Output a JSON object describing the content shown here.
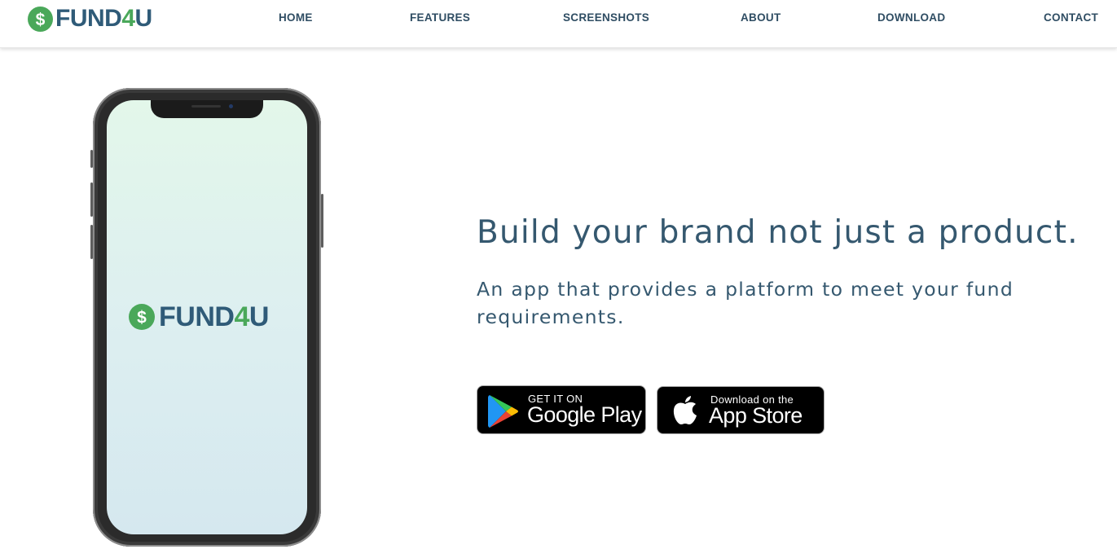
{
  "brand": {
    "name_part_a": "FUND",
    "name_part_b": "4",
    "name_part_c": "U",
    "coin_symbol": "$",
    "icon": "dollar-coin-icon",
    "colors": {
      "navy": "#2f5b78",
      "green": "#4aa85a"
    }
  },
  "nav": {
    "items": [
      {
        "label": "HOME"
      },
      {
        "label": "FEATURES"
      },
      {
        "label": "SCREENSHOTS"
      },
      {
        "label": "ABOUT"
      },
      {
        "label": "DOWNLOAD"
      },
      {
        "label": "CONTACT"
      }
    ]
  },
  "hero": {
    "headline": "Build your brand not just a product.",
    "subheadline": "An app that provides a platform to meet your fund requirements.",
    "text_color": "#35586f"
  },
  "phone": {
    "screen_logo": {
      "name_part_a": "FUND",
      "name_part_b": "4",
      "name_part_c": "U",
      "coin_symbol": "$"
    }
  },
  "badges": {
    "google_play": {
      "small": "GET IT ON",
      "big": "Google Play",
      "icon": "google-play-icon"
    },
    "app_store": {
      "small": "Download on the",
      "big": "App Store",
      "icon": "apple-icon"
    }
  }
}
